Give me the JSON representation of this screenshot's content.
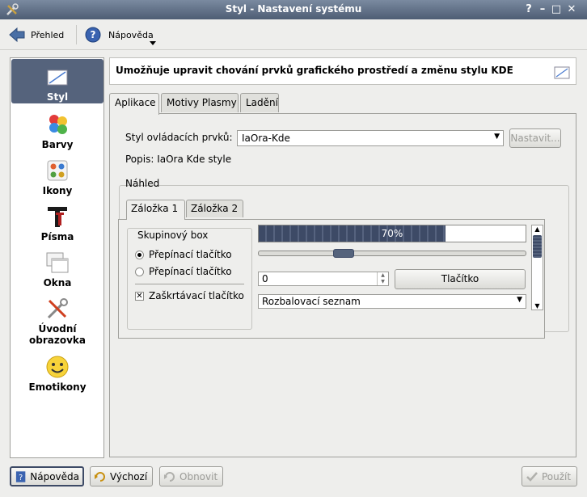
{
  "window": {
    "title": "Styl - Nastavení systému",
    "help_glyph": "?",
    "minimize_glyph": "–",
    "maximize_glyph": "□",
    "close_glyph": "✕"
  },
  "toolbar": {
    "back_label": "Přehled",
    "help_label": "Nápověda"
  },
  "sidebar": {
    "items": [
      {
        "label": "Styl",
        "icon": "style-icon",
        "active": true
      },
      {
        "label": "Barvy",
        "icon": "colors-icon"
      },
      {
        "label": "Ikony",
        "icon": "icons-icon"
      },
      {
        "label": "Písma",
        "icon": "fonts-icon"
      },
      {
        "label": "Okna",
        "icon": "windows-icon"
      },
      {
        "label": "Úvodní obrazovka",
        "icon": "splash-screen-icon"
      },
      {
        "label": "Emotikony",
        "icon": "emoticons-icon"
      }
    ]
  },
  "header": {
    "text": "Umožňuje upravit chování prvků grafického prostředí a změnu stylu KDE"
  },
  "tabs": [
    "Aplikace",
    "Motivy Plasmy",
    "Ladění"
  ],
  "widget_style": {
    "label": "Styl ovládacích prvků:",
    "value": "IaOra-Kde",
    "configure_label": "Nastavit...",
    "description": "Popis: IaOra Kde style"
  },
  "preview": {
    "title": "Náhled",
    "tabs": [
      "Záložka 1",
      "Záložka 2"
    ],
    "group_title": "Skupinový box",
    "radio1_label": "Přepínací tlačítko",
    "radio2_label": "Přepínací tlačítko",
    "checkbox_label": "Zaškrtávací tlačítko",
    "progress_text": "70%",
    "progress_value": 0.7,
    "slider_value": 0.3,
    "spin_value": "0",
    "button_label": "Tlačítko",
    "combo_label": "Rozbalovací seznam"
  },
  "footer": {
    "help_label": "Nápověda",
    "defaults_label": "Výchozí",
    "reset_label": "Obnovit",
    "apply_label": "Použít"
  },
  "colors": {
    "selection": "#55637c",
    "titlebar": "#4e5d74"
  }
}
